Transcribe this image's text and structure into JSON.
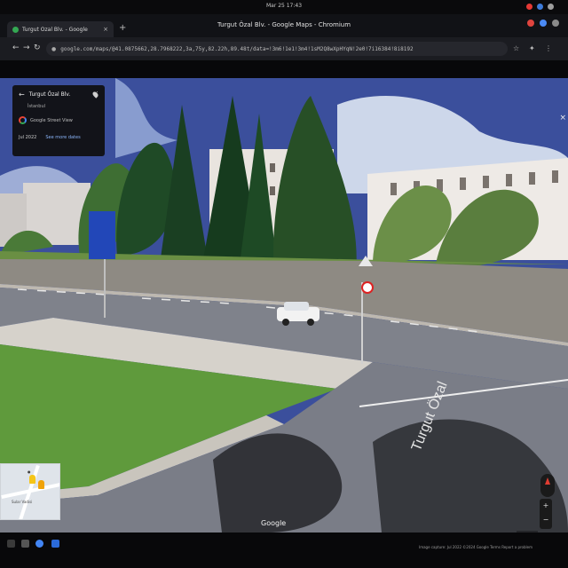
{
  "system": {
    "clock": "Mar 25 17:43"
  },
  "browser": {
    "window_title": "Turgut Özal Blv. - Google Maps - Chromium",
    "tab": {
      "label": "Turgut Özal Blv. - Google",
      "close": "×"
    },
    "new_tab": "+",
    "url": "google.com/maps/@41.0875662,28.7968222,3a,75y,82.22h,89.48t/data=!3m6!1e1!3m4!1sM2Q8wXpHYqN!2e0!7i16384!8i8192"
  },
  "street_view": {
    "place_name": "Turgut Özal Blv.",
    "subtitle": "İstanbul",
    "credit": "Google Street View",
    "date": "Jul 2022",
    "see_more": "See more dates",
    "road_text": "Turgut Özal",
    "watermark": "Google",
    "footer": "Image capture: Jul 2022 ©2024 Google  Terms  Report a problem"
  },
  "minimap": {
    "label": "Sular Vadisi"
  },
  "colors": {
    "sky": "#3b4f9c",
    "grass": "#5f9a3c",
    "road": "#7d8089",
    "sign": "#2247b8"
  }
}
